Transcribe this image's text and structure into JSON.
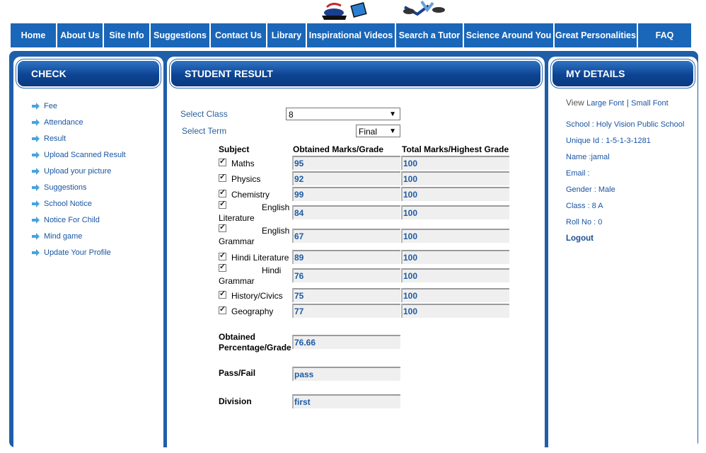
{
  "nav": [
    {
      "label": "Home",
      "w": 64
    },
    {
      "label": "About Us",
      "w": 64
    },
    {
      "label": "Site Info",
      "w": 64
    },
    {
      "label": "Suggestions",
      "w": 83
    },
    {
      "label": "Contact Us",
      "w": 78
    },
    {
      "label": "Library",
      "w": 54
    },
    {
      "label": "Inspirational Videos",
      "w": 124
    },
    {
      "label": "Search a Tutor",
      "w": 94
    },
    {
      "label": "Science Around You",
      "w": 126
    },
    {
      "label": "Great Personalities",
      "w": 116
    },
    {
      "label": "FAQ",
      "w": 75
    }
  ],
  "check": {
    "title": "CHECK",
    "items": [
      "Fee",
      "Attendance",
      "Result",
      "Upload Scanned Result",
      "Upload your picture",
      "Suggestions",
      "School Notice",
      "Notice For Child",
      "Mind game",
      "Update Your Profile"
    ]
  },
  "result": {
    "title": "STUDENT RESULT",
    "select_class_label": "Select Class",
    "select_class_value": "8",
    "select_term_label": "Select Term",
    "select_term_value": "Final",
    "col_subject": "Subject",
    "col_obtained": "Obtained Marks/Grade",
    "col_total": "Total Marks/Highest Grade",
    "rows": [
      {
        "subject": "Maths",
        "obtained": "95",
        "total": "100"
      },
      {
        "subject": "Physics",
        "obtained": "92",
        "total": "100"
      },
      {
        "subject": "Chemistry",
        "obtained": "99",
        "total": "100"
      },
      {
        "subject_line1": "English",
        "subject_line2": "Literature",
        "obtained": "84",
        "total": "100"
      },
      {
        "subject_line1": "English",
        "subject_line2": "Grammar",
        "obtained": "67",
        "total": "100"
      },
      {
        "subject": "Hindi Literature",
        "obtained": "89",
        "total": "100"
      },
      {
        "subject_line1": "Hindi",
        "subject_line2": "Grammar",
        "obtained": "76",
        "total": "100"
      },
      {
        "subject": "History/Civics",
        "obtained": "75",
        "total": "100"
      },
      {
        "subject": "Geography",
        "obtained": "77",
        "total": "100"
      }
    ],
    "percentage_label_1": "Obtained",
    "percentage_label_2": "Percentage/Grade",
    "percentage_value": "76.66",
    "passfail_label": "Pass/Fail",
    "passfail_value": "pass",
    "division_label": "Division",
    "division_value": "first"
  },
  "details": {
    "title": "MY DETAILS",
    "view_label": "View",
    "large_font": "Large Font",
    "sep": "|",
    "small_font": "Small Font",
    "school": "School : Holy Vision Public School",
    "unique_id": "Unique Id : 1-5-1-3-1281",
    "name": "Name :jamal",
    "email": "Email :",
    "gender": "Gender : Male",
    "class": "Class : 8 A",
    "roll": "Roll No : 0",
    "logout": "Logout"
  }
}
